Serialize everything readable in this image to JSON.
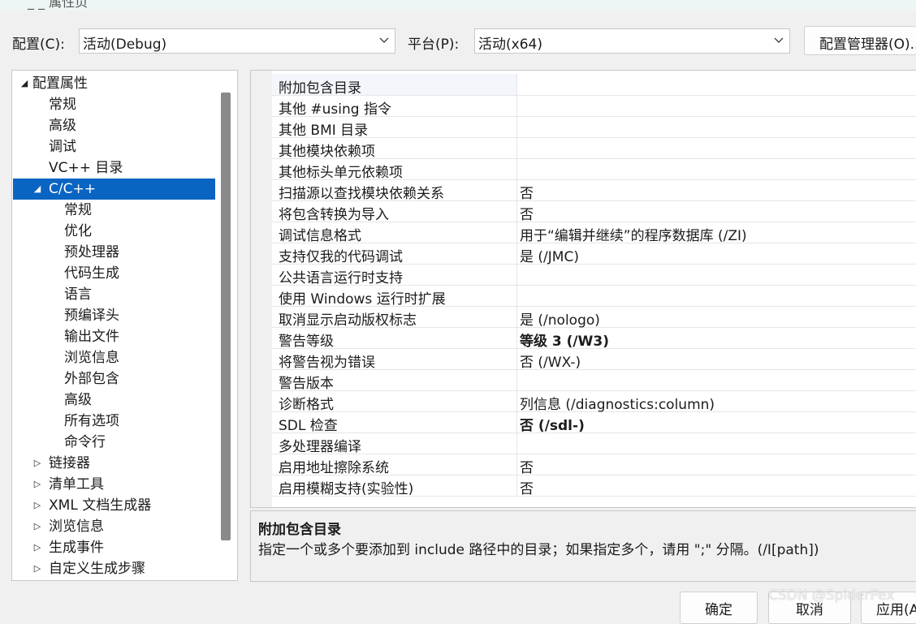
{
  "title_fragment": "_  _ 属性页",
  "config": {
    "label": "配置(C):",
    "value": "活动(Debug)"
  },
  "platform": {
    "label": "平台(P):",
    "value": "活动(x64)"
  },
  "config_manager_button": "配置管理器(O)...",
  "tree": [
    {
      "label": "配置属性",
      "level": 0,
      "arrow": "expanded"
    },
    {
      "label": "常规",
      "level": 1,
      "arrow": "none"
    },
    {
      "label": "高级",
      "level": 1,
      "arrow": "none"
    },
    {
      "label": "调试",
      "level": 1,
      "arrow": "none"
    },
    {
      "label": "VC++ 目录",
      "level": 1,
      "arrow": "none"
    },
    {
      "label": "C/C++",
      "level": 1,
      "arrow": "expanded",
      "selected": true
    },
    {
      "label": "常规",
      "level": 2,
      "arrow": "none"
    },
    {
      "label": "优化",
      "level": 2,
      "arrow": "none"
    },
    {
      "label": "预处理器",
      "level": 2,
      "arrow": "none"
    },
    {
      "label": "代码生成",
      "level": 2,
      "arrow": "none"
    },
    {
      "label": "语言",
      "level": 2,
      "arrow": "none"
    },
    {
      "label": "预编译头",
      "level": 2,
      "arrow": "none"
    },
    {
      "label": "输出文件",
      "level": 2,
      "arrow": "none"
    },
    {
      "label": "浏览信息",
      "level": 2,
      "arrow": "none"
    },
    {
      "label": "外部包含",
      "level": 2,
      "arrow": "none"
    },
    {
      "label": "高级",
      "level": 2,
      "arrow": "none"
    },
    {
      "label": "所有选项",
      "level": 2,
      "arrow": "none"
    },
    {
      "label": "命令行",
      "level": 2,
      "arrow": "none"
    },
    {
      "label": "链接器",
      "level": 1,
      "arrow": "collapsed"
    },
    {
      "label": "清单工具",
      "level": 1,
      "arrow": "collapsed"
    },
    {
      "label": "XML 文档生成器",
      "level": 1,
      "arrow": "collapsed"
    },
    {
      "label": "浏览信息",
      "level": 1,
      "arrow": "collapsed"
    },
    {
      "label": "生成事件",
      "level": 1,
      "arrow": "collapsed"
    },
    {
      "label": "自定义生成步骤",
      "level": 1,
      "arrow": "collapsed"
    }
  ],
  "properties": [
    {
      "name": "附加包含目录",
      "value": "",
      "selected": true
    },
    {
      "name": "其他 #using 指令",
      "value": ""
    },
    {
      "name": "其他 BMI 目录",
      "value": ""
    },
    {
      "name": "其他模块依赖项",
      "value": ""
    },
    {
      "name": "其他标头单元依赖项",
      "value": ""
    },
    {
      "name": "扫描源以查找模块依赖关系",
      "value": "否"
    },
    {
      "name": "将包含转换为导入",
      "value": "否"
    },
    {
      "name": "调试信息格式",
      "value": "用于“编辑并继续”的程序数据库 (/ZI)"
    },
    {
      "name": "支持仅我的代码调试",
      "value": "是 (/JMC)"
    },
    {
      "name": "公共语言运行时支持",
      "value": ""
    },
    {
      "name": "使用 Windows 运行时扩展",
      "value": ""
    },
    {
      "name": "取消显示启动版权标志",
      "value": "是 (/nologo)"
    },
    {
      "name": "警告等级",
      "value": "等级 3 (/W3)",
      "bold": true
    },
    {
      "name": "将警告视为错误",
      "value": "否 (/WX-)"
    },
    {
      "name": "警告版本",
      "value": ""
    },
    {
      "name": "诊断格式",
      "value": "列信息 (/diagnostics:column)"
    },
    {
      "name": "SDL 检查",
      "value": "否 (/sdl-)",
      "bold": true
    },
    {
      "name": "多处理器编译",
      "value": ""
    },
    {
      "name": "启用地址擦除系统",
      "value": "否"
    },
    {
      "name": "启用模糊支持(实验性)",
      "value": "否"
    }
  ],
  "description": {
    "title": "附加包含目录",
    "body": "指定一个或多个要添加到 include 路径中的目录；如果指定多个，请用 \";\" 分隔。(/I[path])"
  },
  "buttons": {
    "ok": "确定",
    "cancel": "取消",
    "apply": "应用(A)"
  },
  "watermark": "CSDN @SpiderPex",
  "colors": {
    "selection": "#0a64c2",
    "background": "#f0f0f0"
  }
}
